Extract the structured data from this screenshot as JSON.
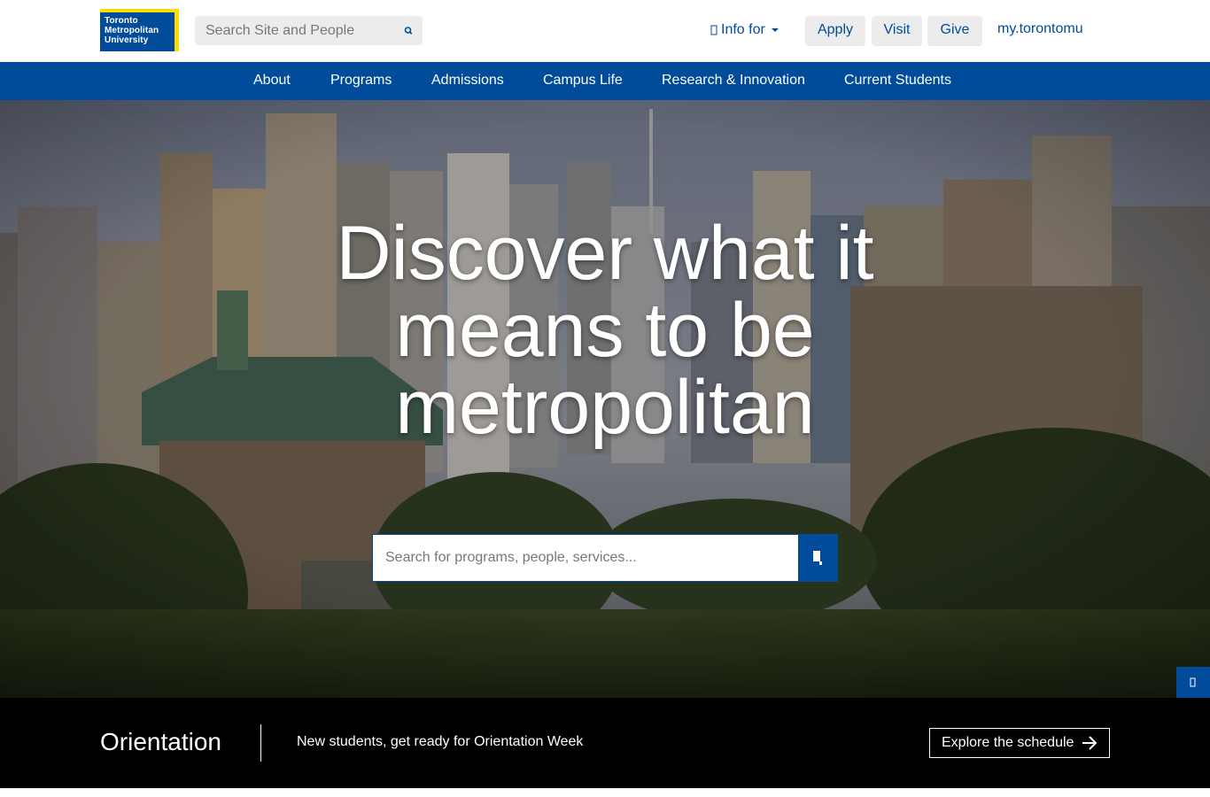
{
  "header": {
    "logo_lines": [
      "Toronto",
      "Metropolitan",
      "University"
    ],
    "search_placeholder": "Search Site and People",
    "info_for_label": "Info for",
    "apply_label": "Apply",
    "visit_label": "Visit",
    "give_label": "Give",
    "my_link_label": "my.torontomu"
  },
  "nav": {
    "items": [
      {
        "label": "About"
      },
      {
        "label": "Programs"
      },
      {
        "label": "Admissions"
      },
      {
        "label": "Campus Life"
      },
      {
        "label": "Research & Innovation"
      },
      {
        "label": "Current Students"
      }
    ]
  },
  "hero": {
    "headline_lines": [
      "Discover what it",
      "means to be",
      "metropolitan"
    ],
    "search_placeholder": "Search for programs, people, services..."
  },
  "banner": {
    "title": "Orientation",
    "description": "New students, get ready for Orientation Week",
    "cta_label": "Explore the schedule"
  },
  "icons": {
    "site_search": "search-icon",
    "hero_search": "search-icon",
    "info_for": "info-icon",
    "cta": "arrow-right-icon",
    "side_tab": "feedback-icon"
  },
  "colors": {
    "brand_blue": "#004c9b",
    "brand_yellow": "#ffdc00",
    "pill_bg": "#ececec",
    "banner_bg": "#000000"
  }
}
